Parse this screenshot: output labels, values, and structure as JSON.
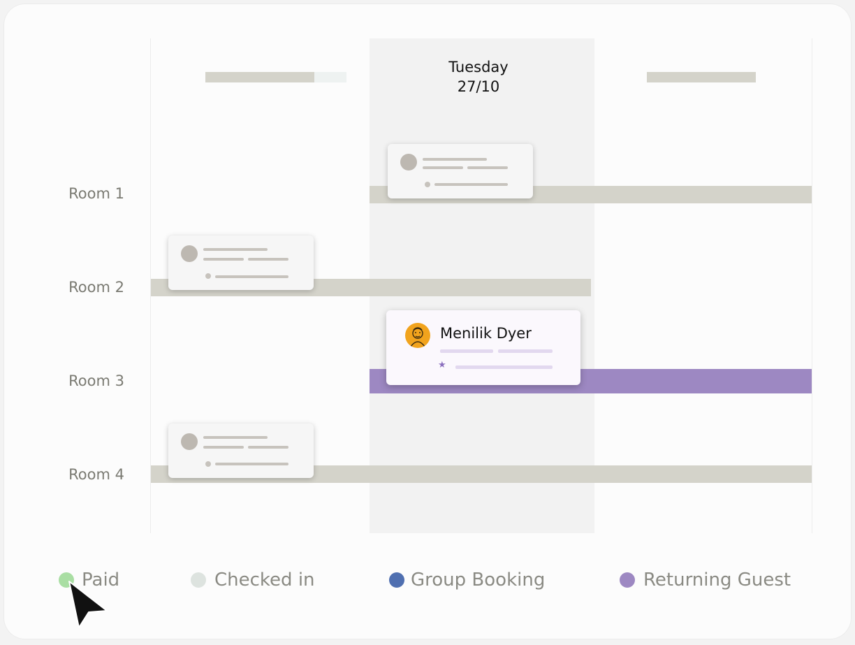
{
  "header": {
    "day_name": "Tuesday",
    "day_date": "27/10"
  },
  "rooms": [
    {
      "label": "Room 1"
    },
    {
      "label": "Room 2"
    },
    {
      "label": "Room 3"
    },
    {
      "label": "Room 4"
    }
  ],
  "featured_booking": {
    "guest_name": "Menilik Dyer",
    "status": "Returning Guest",
    "icon": "star-icon"
  },
  "legend": [
    {
      "label": "Paid",
      "color": "#a9dea3"
    },
    {
      "label": "Checked in",
      "color": "#dde3df"
    },
    {
      "label": "Group Booking",
      "color": "#4f6fb0"
    },
    {
      "label": "Returning Guest",
      "color": "#9d88c2"
    }
  ],
  "colors": {
    "booking_bar": "#d4d3ca",
    "returning_guest_bar": "#9d88c2",
    "highlighted_day": "#f2f2f2"
  }
}
